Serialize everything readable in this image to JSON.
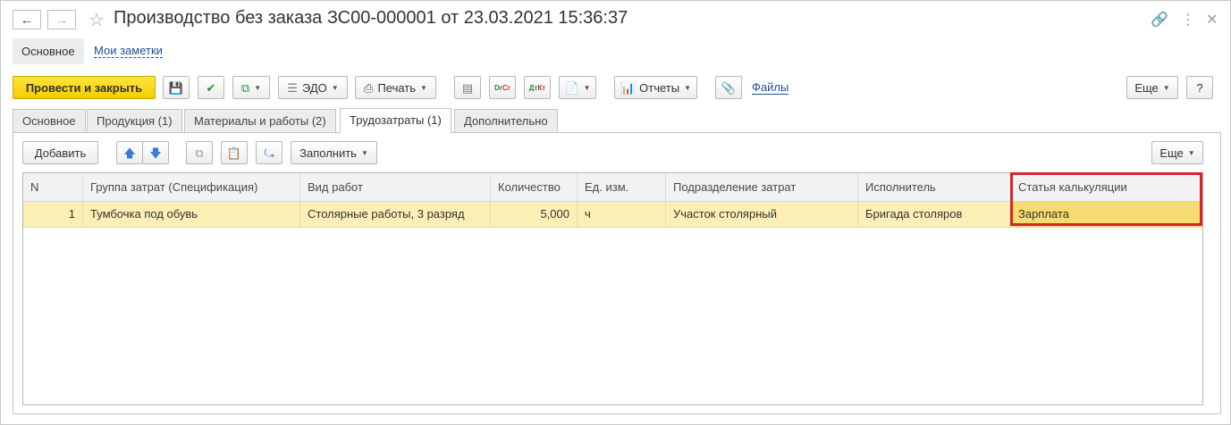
{
  "window": {
    "title": "Производство без заказа ЗС00-000001 от 23.03.2021 15:36:37",
    "back_icon": "arrow-left-icon",
    "forward_icon": "arrow-right-icon",
    "favorite_icon": "star-icon",
    "link_icon": "link-icon",
    "more_icon": "vertical-dots-icon",
    "close_icon": "close-icon"
  },
  "subnav": {
    "main": "Основное",
    "notes": "Мои заметки"
  },
  "toolbar": {
    "post_close": "Провести и закрыть",
    "edo": "ЭДО",
    "print": "Печать",
    "reports": "Отчеты",
    "files": "Файлы",
    "more": "Еще",
    "help": "?",
    "dt_kt": "Dr Cr",
    "dt_kt_ru": "Дт Кт"
  },
  "tabs": [
    {
      "label": "Основное"
    },
    {
      "label": "Продукция (1)"
    },
    {
      "label": "Материалы и работы (2)"
    },
    {
      "label": "Трудозатраты (1)"
    },
    {
      "label": "Дополнительно"
    }
  ],
  "table_toolbar": {
    "add": "Добавить",
    "fill": "Заполнить",
    "more": "Еще"
  },
  "table": {
    "columns": [
      "N",
      "Группа затрат (Спецификация)",
      "Вид работ",
      "Количество",
      "Ед. изм.",
      "Подразделение затрат",
      "Исполнитель",
      "Статья калькуляции"
    ],
    "rows": [
      {
        "n": "1",
        "group": "Тумбочка под обувь",
        "work": "Столярные работы, 3 разряд",
        "qty": "5,000",
        "unit": "ч",
        "dept": "Участок столярный",
        "executor": "Бригада столяров",
        "article": "Зарплата"
      }
    ]
  },
  "colors": {
    "accent_primary": "#f5cd00",
    "selected_row": "#fbefb5",
    "highlight_border": "#d6262a",
    "link": "#1f4e96"
  }
}
